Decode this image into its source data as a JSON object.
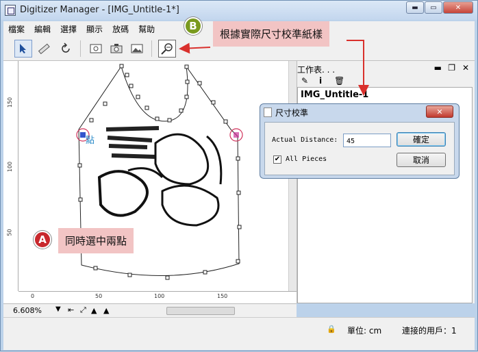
{
  "window": {
    "title": "Digitizer Manager - [IMG_Untitle-1*]",
    "minimize": "▬",
    "maximize": "▭",
    "close": "✕"
  },
  "menu": [
    "檔案",
    "編輯",
    "選擇",
    "顯示",
    "放碼",
    "幫助"
  ],
  "ruler": {
    "vertical": [
      "150",
      "100",
      "50"
    ],
    "horizontal": [
      "0",
      "50",
      "100",
      "150"
    ]
  },
  "zoom": "6.608%",
  "status": {
    "unit": "單位: cm",
    "connected": "連接的用戶：1"
  },
  "work_panel": {
    "title": "工作表. . .",
    "item": "IMG_Untitle-1"
  },
  "dialog": {
    "title": "尺寸校準",
    "distance_label": "Actual Distance:",
    "distance_value": "45",
    "checkbox_label": "All Pieces",
    "checkbox_checked": true,
    "ok": "確定",
    "cancel": "取消"
  },
  "annotations": {
    "a_badge": "A",
    "a_text": "同時選中兩點",
    "b_badge": "B",
    "b_text": "根據實際尺寸校準紙樣",
    "point_label": "點"
  },
  "colors": {
    "badge_red": "#c8282d",
    "badge_green": "#7a9a1e",
    "annotation_bg": "#f2c4c4",
    "arrow": "#d9302c"
  }
}
